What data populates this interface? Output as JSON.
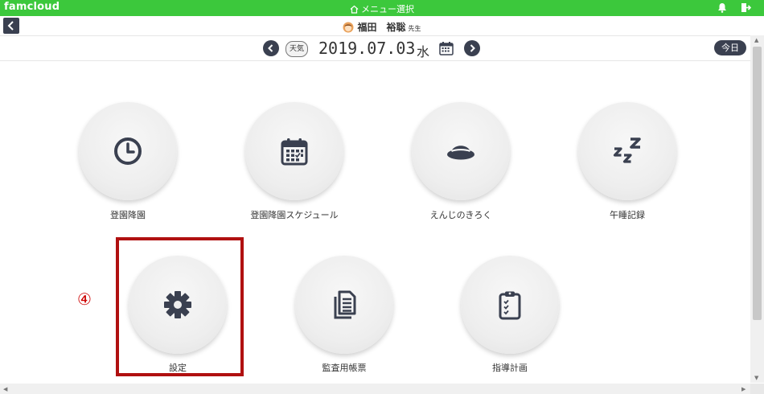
{
  "app": {
    "brand": "famcloud",
    "screen_title": "メニュー選択"
  },
  "user": {
    "name": "福田　裕聡",
    "suffix": "先生"
  },
  "datebar": {
    "weather_label": "天気",
    "date": "2019.07.03",
    "weekday": "水",
    "today_label": "今日"
  },
  "menu": {
    "items": [
      {
        "label": "登園降園",
        "icon": "clock-icon"
      },
      {
        "label": "登園降園スケジュール",
        "icon": "calendar-icon"
      },
      {
        "label": "えんじのきろく",
        "icon": "hat-icon"
      },
      {
        "label": "午睡記録",
        "icon": "sleep-icon"
      },
      {
        "label": "設定",
        "icon": "gear-icon"
      },
      {
        "label": "監査用帳票",
        "icon": "documents-icon"
      },
      {
        "label": "指導計画",
        "icon": "clipboard-icon"
      }
    ]
  },
  "annotation": {
    "step_marker": "④",
    "highlight_color": "#b01010"
  },
  "colors": {
    "header_green": "#3cc83c",
    "dark_button": "#3a4050",
    "icon_color": "#3a4050"
  }
}
